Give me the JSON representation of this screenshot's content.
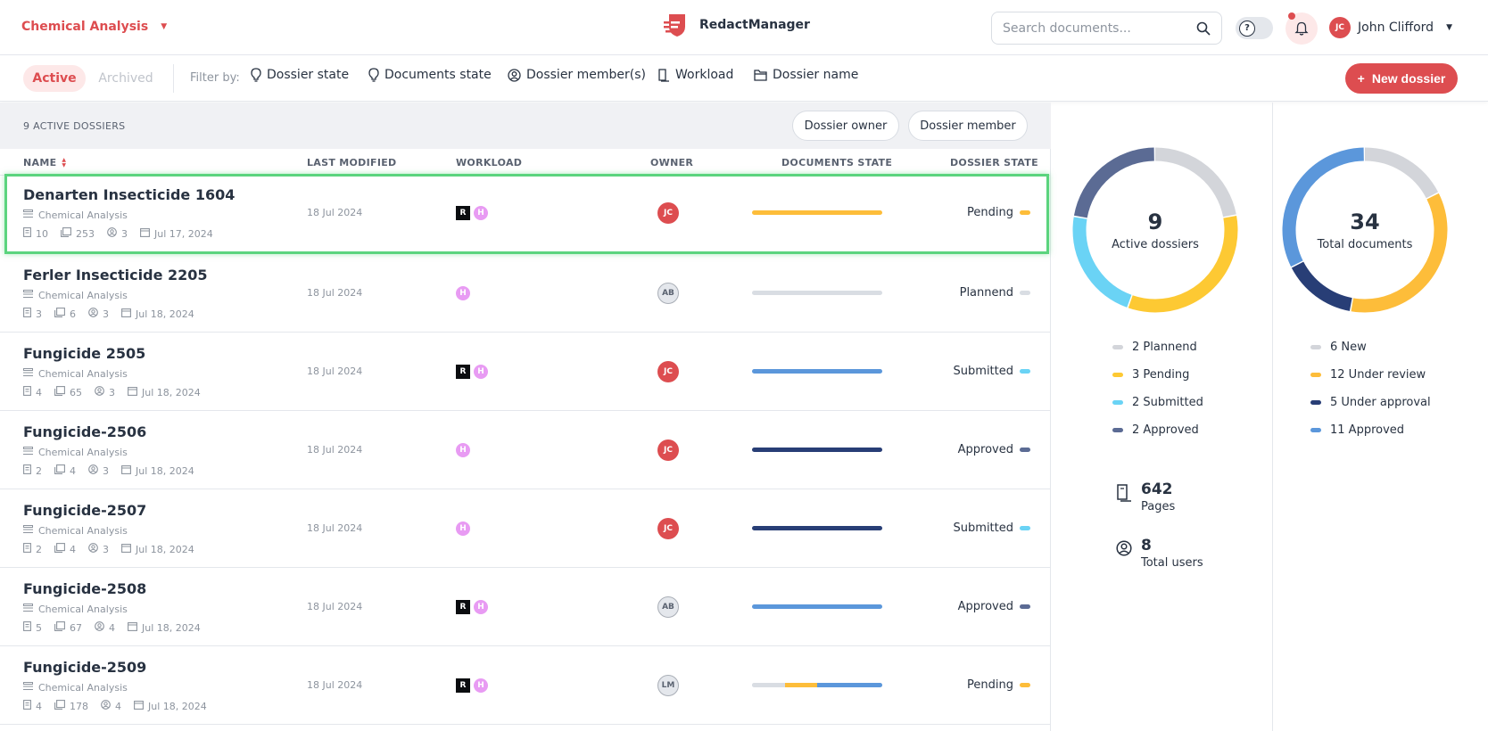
{
  "header": {
    "workspace": "Chemical Analysis",
    "brand": "RedactManager",
    "search_placeholder": "Search documents...",
    "user_initials": "JC",
    "user_name": "John Clifford"
  },
  "filters": {
    "active_tab": "Active",
    "archived_tab": "Archived",
    "filter_by": "Filter by:",
    "items": [
      "Dossier state",
      "Documents state",
      "Dossier member(s)",
      "Workload",
      "Dossier name"
    ],
    "new_button": "New dossier"
  },
  "table": {
    "count_label": "9 ACTIVE DOSSIERS",
    "owner_button": "Dossier owner",
    "member_button": "Dossier member",
    "columns": [
      "NAME",
      "LAST MODIFIED",
      "WORKLOAD",
      "OWNER",
      "DOCUMENTS STATE",
      "DOSSIER STATE"
    ],
    "rows": [
      {
        "title": "Denarten Insecticide 1604",
        "template": "Chemical Analysis",
        "docs": "10",
        "pages": "253",
        "members": "3",
        "date": "Jul 17, 2024",
        "modified": "18 Jul 2024",
        "workload": [
          "R",
          "H"
        ],
        "owner": "JC",
        "owner_style": "jc",
        "doc_bar": [
          {
            "color": "#fdbd3a",
            "fraction": 1.0
          }
        ],
        "state": "Pending",
        "state_color": "#fdbd3a",
        "selected": true
      },
      {
        "title": "Ferler Insecticide 2205",
        "template": "Chemical Analysis",
        "docs": "3",
        "pages": "6",
        "members": "3",
        "date": "Jul 18, 2024",
        "modified": "18 Jul 2024",
        "workload": [
          "H"
        ],
        "owner": "AB",
        "owner_style": "gray",
        "doc_bar": [
          {
            "color": "#d9dde3",
            "fraction": 1.0
          }
        ],
        "state": "Plannend",
        "state_color": "#d9dde3",
        "selected": false
      },
      {
        "title": "Fungicide 2505",
        "template": "Chemical Analysis",
        "docs": "4",
        "pages": "65",
        "members": "3",
        "date": "Jul 18, 2024",
        "modified": "18 Jul 2024",
        "workload": [
          "R",
          "H"
        ],
        "owner": "JC",
        "owner_style": "jc",
        "doc_bar": [
          {
            "color": "#5b97db",
            "fraction": 1.0
          }
        ],
        "state": "Submitted",
        "state_color": "#6ad3f5",
        "selected": false
      },
      {
        "title": "Fungicide-2506",
        "template": "Chemical Analysis",
        "docs": "2",
        "pages": "4",
        "members": "3",
        "date": "Jul 18, 2024",
        "modified": "18 Jul 2024",
        "workload": [
          "H"
        ],
        "owner": "JC",
        "owner_style": "jc",
        "doc_bar": [
          {
            "color": "#283e76",
            "fraction": 1.0
          }
        ],
        "state": "Approved",
        "state_color": "#5b6b94",
        "selected": false
      },
      {
        "title": "Fungicide-2507",
        "template": "Chemical Analysis",
        "docs": "2",
        "pages": "4",
        "members": "3",
        "date": "Jul 18, 2024",
        "modified": "18 Jul 2024",
        "workload": [
          "H"
        ],
        "owner": "JC",
        "owner_style": "jc",
        "doc_bar": [
          {
            "color": "#283e76",
            "fraction": 1.0
          }
        ],
        "state": "Submitted",
        "state_color": "#6ad3f5",
        "selected": false
      },
      {
        "title": "Fungicide-2508",
        "template": "Chemical Analysis",
        "docs": "5",
        "pages": "67",
        "members": "4",
        "date": "Jul 18, 2024",
        "modified": "18 Jul 2024",
        "workload": [
          "R",
          "H"
        ],
        "owner": "AB",
        "owner_style": "gray",
        "doc_bar": [
          {
            "color": "#5b97db",
            "fraction": 1.0
          }
        ],
        "state": "Approved",
        "state_color": "#5b6b94",
        "selected": false
      },
      {
        "title": "Fungicide-2509",
        "template": "Chemical Analysis",
        "docs": "4",
        "pages": "178",
        "members": "4",
        "date": "Jul 18, 2024",
        "modified": "18 Jul 2024",
        "workload": [
          "R",
          "H"
        ],
        "owner": "LM",
        "owner_style": "gray",
        "doc_bar": [
          {
            "color": "#d9dde3",
            "fraction": 0.25
          },
          {
            "color": "#fdbd3a",
            "fraction": 0.25
          },
          {
            "color": "#5b97db",
            "fraction": 0.5
          }
        ],
        "state": "Pending",
        "state_color": "#fdbd3a",
        "selected": false
      }
    ]
  },
  "stats": {
    "dossiers": {
      "total": "9",
      "label": "Active dossiers",
      "segments": [
        {
          "label": "2 Plannend",
          "value": 2,
          "color": "#d3d5da"
        },
        {
          "label": "3 Pending",
          "value": 3,
          "color": "#fdc933"
        },
        {
          "label": "2 Submitted",
          "value": 2,
          "color": "#6ad3f5"
        },
        {
          "label": "2 Approved",
          "value": 2,
          "color": "#5b6b94"
        }
      ]
    },
    "documents": {
      "total": "34",
      "label": "Total documents",
      "segments": [
        {
          "label": "6 New",
          "value": 6,
          "color": "#d3d5da"
        },
        {
          "label": "12 Under review",
          "value": 12,
          "color": "#fdbd3a"
        },
        {
          "label": "5 Under approval",
          "value": 5,
          "color": "#283e76"
        },
        {
          "label": "11 Approved",
          "value": 11,
          "color": "#5b97db"
        }
      ]
    },
    "pages_value": "642",
    "pages_label": "Pages",
    "users_value": "8",
    "users_label": "Total users"
  }
}
